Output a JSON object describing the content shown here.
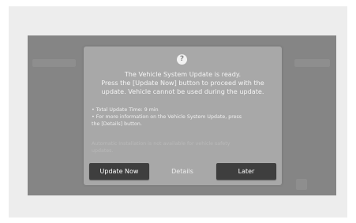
{
  "dialog": {
    "help_icon_glyph": "?",
    "message_lines": [
      "The Vehicle System Update is ready.",
      "Press the [Update Now] button to proceed with the",
      "update. Vehicle cannot be used during the update."
    ],
    "info_lines": [
      "• Total Update Time: 9 min",
      "• For more information on the Vehicle System Update, press",
      "the [Details] button."
    ],
    "note_lines": [
      "Automatic Installation is not available for vehicle safety",
      "updates."
    ],
    "buttons": {
      "update_now": "Update Now",
      "details": "Details",
      "later": "Later"
    }
  },
  "colors": {
    "screen_overlay": "#858585",
    "dialog_background": "#a8a8a8",
    "button_dark": "#3e3e3e"
  },
  "icons": {
    "help": "question-circle-icon"
  }
}
